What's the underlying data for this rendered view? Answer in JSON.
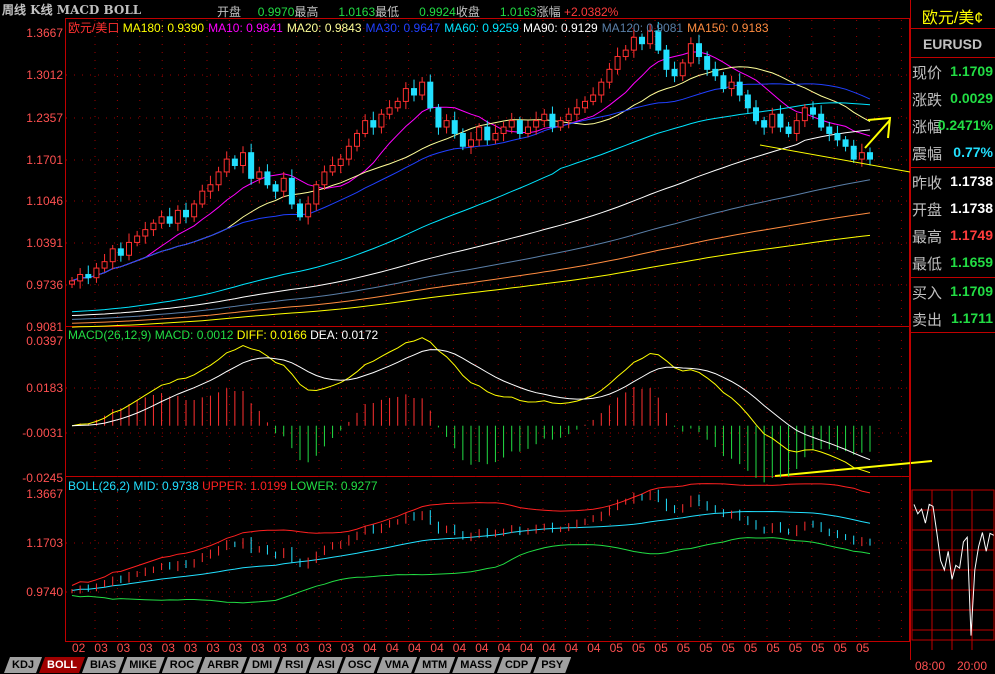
{
  "header": {
    "title": "周线 K线 MACD BOLL",
    "open_label": "开盘",
    "open": "0.9970",
    "high_label": "最高",
    "high": "1.0163",
    "low_label": "最低",
    "low": "0.9924",
    "close_label": "收盘",
    "close": "1.0163",
    "change_label": "涨幅",
    "change": "+2.0382%"
  },
  "main_legend": {
    "name": "欧元/美口",
    "items": [
      {
        "text": "MA180: 0.9390",
        "color": "#ffff00"
      },
      {
        "text": "MA10: 0.9841",
        "color": "#ff00ff"
      },
      {
        "text": "MA20: 0.9843",
        "color": "#ffff99"
      },
      {
        "text": "MA30: 0.9647",
        "color": "#2040ff"
      },
      {
        "text": "MA60: 0.9259",
        "color": "#00e5ff"
      },
      {
        "text": "MA90: 0.9129",
        "color": "#ffffff"
      },
      {
        "text": "MA120: 0.9081",
        "color": "#5a7fa8"
      },
      {
        "text": "MA150: 0.9183",
        "color": "#ff8c40"
      }
    ]
  },
  "macd_legend": {
    "name": "MACD(26,12,9)",
    "macd": "MACD: 0.0012",
    "diff": "DIFF: 0.0166",
    "dea": "DEA: 0.0172"
  },
  "boll_legend": {
    "name": "BOLL(26,2)",
    "mid": "MID: 0.9738",
    "upper": "UPPER: 1.0199",
    "lower": "LOWER: 0.9277"
  },
  "axes": {
    "main": [
      "1.3667",
      "1.3012",
      "1.2357",
      "1.1701",
      "1.1046",
      "1.0391",
      "0.9736",
      "0.9081"
    ],
    "macd": [
      "0.0397",
      "0.0183",
      "-0.0031",
      "-0.0245"
    ],
    "boll": [
      "1.3667",
      "1.1703",
      "0.9740"
    ],
    "x": [
      "02",
      "03",
      "03",
      "03",
      "03",
      "03",
      "03",
      "03",
      "03",
      "03",
      "03",
      "03",
      "03",
      "04",
      "04",
      "04",
      "04",
      "04",
      "04",
      "04",
      "04",
      "04",
      "04",
      "04",
      "05",
      "05",
      "05",
      "05",
      "05",
      "05",
      "05",
      "05",
      "05",
      "05",
      "05",
      "05"
    ],
    "intraday_x": [
      "08:00",
      "20:00"
    ]
  },
  "panel": {
    "name": "欧元/美¢",
    "code": "EURUSD",
    "rows": [
      {
        "label": "现价",
        "value": "1.1709",
        "color": "#22dd44"
      },
      {
        "label": "涨跌",
        "value": "0.0029",
        "color": "#22dd44"
      },
      {
        "label": "涨幅",
        "value": "0.2471%",
        "color": "#22dd44"
      },
      {
        "label": "震幅",
        "value": "0.77%",
        "color": "#22e0ff"
      },
      {
        "label": "昨收",
        "value": "1.1738",
        "color": "#ffffff"
      },
      {
        "label": "开盘",
        "value": "1.1738",
        "color": "#ffffff"
      },
      {
        "label": "最高",
        "value": "1.1749",
        "color": "#ff3c3c"
      },
      {
        "label": "最低",
        "value": "1.1659",
        "color": "#22dd44"
      },
      {
        "label": "买入",
        "value": "1.1709",
        "color": "#22dd44"
      },
      {
        "label": "卖出",
        "value": "1.1711",
        "color": "#22dd44"
      }
    ]
  },
  "tabs": [
    "KDJ",
    "BOLL",
    "BIAS",
    "MIKE",
    "ROC",
    "ARBR",
    "DMI",
    "RSI",
    "ASI",
    "OSC",
    "VMA",
    "MTM",
    "MASS",
    "CDP",
    "PSY"
  ],
  "active_tab": "BOLL",
  "chart_data": {
    "type": "candlestick",
    "title": "欧元/美元 周线",
    "ylim": [
      0.9081,
      1.3667
    ],
    "closes": [
      0.98,
      0.99,
      0.985,
      1.0,
      1.01,
      1.03,
      1.02,
      1.04,
      1.05,
      1.06,
      1.07,
      1.08,
      1.07,
      1.09,
      1.08,
      1.1,
      1.12,
      1.13,
      1.15,
      1.17,
      1.16,
      1.18,
      1.14,
      1.15,
      1.13,
      1.12,
      1.14,
      1.1,
      1.08,
      1.1,
      1.13,
      1.15,
      1.16,
      1.17,
      1.19,
      1.21,
      1.23,
      1.22,
      1.24,
      1.25,
      1.26,
      1.28,
      1.27,
      1.29,
      1.25,
      1.22,
      1.23,
      1.21,
      1.19,
      1.2,
      1.22,
      1.2,
      1.21,
      1.22,
      1.23,
      1.21,
      1.22,
      1.23,
      1.24,
      1.22,
      1.23,
      1.24,
      1.25,
      1.26,
      1.27,
      1.29,
      1.31,
      1.33,
      1.34,
      1.36,
      1.35,
      1.37,
      1.34,
      1.31,
      1.3,
      1.32,
      1.35,
      1.33,
      1.31,
      1.3,
      1.28,
      1.29,
      1.27,
      1.25,
      1.23,
      1.22,
      1.24,
      1.22,
      1.21,
      1.23,
      1.25,
      1.24,
      1.22,
      1.21,
      1.2,
      1.19,
      1.17,
      1.18,
      1.17
    ],
    "ma_periods": [
      10,
      20,
      30,
      60,
      90,
      120,
      150,
      180
    ],
    "intraday": [
      1.174,
      1.173,
      1.1735,
      1.172,
      1.174,
      1.1738,
      1.171,
      1.168,
      1.167,
      1.169,
      1.166,
      1.1675,
      1.1672,
      1.17,
      1.1705,
      1.16,
      1.167,
      1.1695,
      1.171,
      1.169,
      1.1709,
      1.1707
    ]
  }
}
